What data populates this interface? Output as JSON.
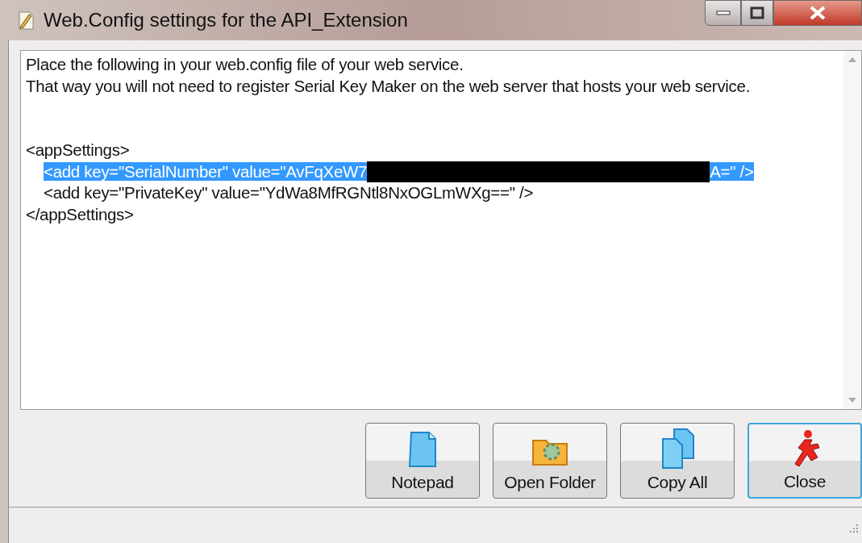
{
  "window": {
    "title": "Web.Config settings for the API_Extension"
  },
  "text_lines": [
    {
      "kind": "text",
      "indented": false,
      "selected": false,
      "text": "Place the following in your web.config file of your web service."
    },
    {
      "kind": "text",
      "indented": false,
      "selected": false,
      "text": "That way you will not need to register Serial Key Maker on the web server that hosts your web service."
    },
    {
      "kind": "blank"
    },
    {
      "kind": "blank"
    },
    {
      "kind": "text",
      "indented": false,
      "selected": false,
      "text": "<appSettings>"
    },
    {
      "kind": "redacted",
      "indented": true,
      "selected": true,
      "before": "<add key=\"SerialNumber\" value=\"AvFqXeW7",
      "after": "A=\" />"
    },
    {
      "kind": "text",
      "indented": true,
      "selected": false,
      "text": "<add key=\"PrivateKey\" value=\"YdWa8MfRGNtl8NxOGLmWXg==\" />"
    },
    {
      "kind": "text",
      "indented": false,
      "selected": false,
      "text": "</appSettings>"
    }
  ],
  "buttons": [
    {
      "kind": "document",
      "label": "Notepad",
      "focused": false
    },
    {
      "kind": "folder",
      "label": "Open Folder",
      "focused": false
    },
    {
      "kind": "copy",
      "label": "Copy All",
      "focused": false
    },
    {
      "kind": "exit",
      "label": "Close",
      "focused": true
    }
  ]
}
